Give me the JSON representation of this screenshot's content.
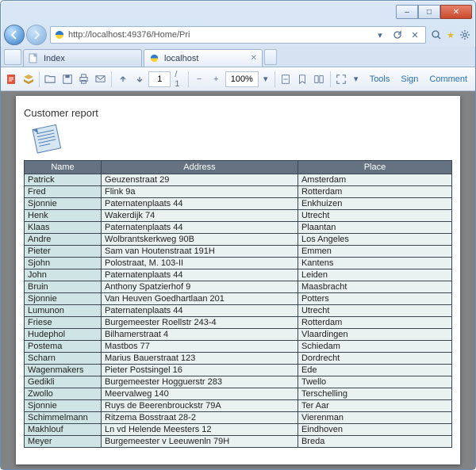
{
  "browser": {
    "url": "http://localhost:49376/Home/Pri",
    "tabs": [
      {
        "label": "Index"
      },
      {
        "label": "localhost"
      }
    ],
    "window_buttons": {
      "min": "–",
      "max": "□",
      "close": "✕"
    }
  },
  "pdf_toolbar": {
    "page_current": "1",
    "page_total": "/ 1",
    "zoom_value": "100%",
    "tools_label": "Tools",
    "sign_label": "Sign",
    "comment_label": "Comment"
  },
  "report": {
    "title": "Customer report",
    "columns": {
      "name": "Name",
      "address": "Address",
      "place": "Place"
    },
    "rows": [
      {
        "name": "Patrick",
        "address": "Geuzenstraat 29",
        "place": "Amsterdam"
      },
      {
        "name": "Fred",
        "address": "Flink 9a",
        "place": "Rotterdam"
      },
      {
        "name": "Sjonnie",
        "address": "Paternatenplaats 44",
        "place": "Enkhuizen"
      },
      {
        "name": "Henk",
        "address": "Wakerdijk 74",
        "place": "Utrecht"
      },
      {
        "name": "Klaas",
        "address": "Paternatenplaats 44",
        "place": "Plaantan"
      },
      {
        "name": "Andre",
        "address": "Wolbrantskerkweg 90B",
        "place": "Los Angeles"
      },
      {
        "name": "Pieter",
        "address": "Sam van Houtenstraat 191H",
        "place": "Emmen"
      },
      {
        "name": "Sjohn",
        "address": "Polostraat, M. 103-II",
        "place": "Kantens"
      },
      {
        "name": "John",
        "address": "Paternatenplaats 44",
        "place": "Leiden"
      },
      {
        "name": "Bruin",
        "address": "Anthony Spatzierhof 9",
        "place": "Maasbracht"
      },
      {
        "name": "Sjonnie",
        "address": "Van Heuven Goedhartlaan 201",
        "place": "Potters"
      },
      {
        "name": "Lumunon",
        "address": "Paternatenplaats 44",
        "place": "Utrecht"
      },
      {
        "name": "Friese",
        "address": "Burgemeester Roellstr 243-4",
        "place": "Rotterdam"
      },
      {
        "name": "Hudephol",
        "address": "Bilhamerstraat 4",
        "place": "Vlaardingen"
      },
      {
        "name": "Postema",
        "address": "Mastbos 77",
        "place": "Schiedam"
      },
      {
        "name": "Scharn",
        "address": "Marius Bauerstraat 123",
        "place": "Dordrecht"
      },
      {
        "name": "Wagenmakers",
        "address": "Pieter Postsingel 16",
        "place": "Ede"
      },
      {
        "name": "Gedikli",
        "address": "Burgemeester Hogguerstr 283",
        "place": "Twello"
      },
      {
        "name": "Zwollo",
        "address": "Meervalweg 140",
        "place": "Terschelling"
      },
      {
        "name": "Sjonnie",
        "address": "Ruys de Beerenbrouckstr 79A",
        "place": "Ter Aar"
      },
      {
        "name": "Schimmelmann",
        "address": "Ritzema Bosstraat 28-2",
        "place": "Vierenman"
      },
      {
        "name": "Makhlouf",
        "address": "Ln vd Helende Meesters 12",
        "place": "Eindhoven"
      },
      {
        "name": "Meyer",
        "address": "Burgemeester v Leeuwenln 79H",
        "place": "Breda"
      }
    ]
  }
}
